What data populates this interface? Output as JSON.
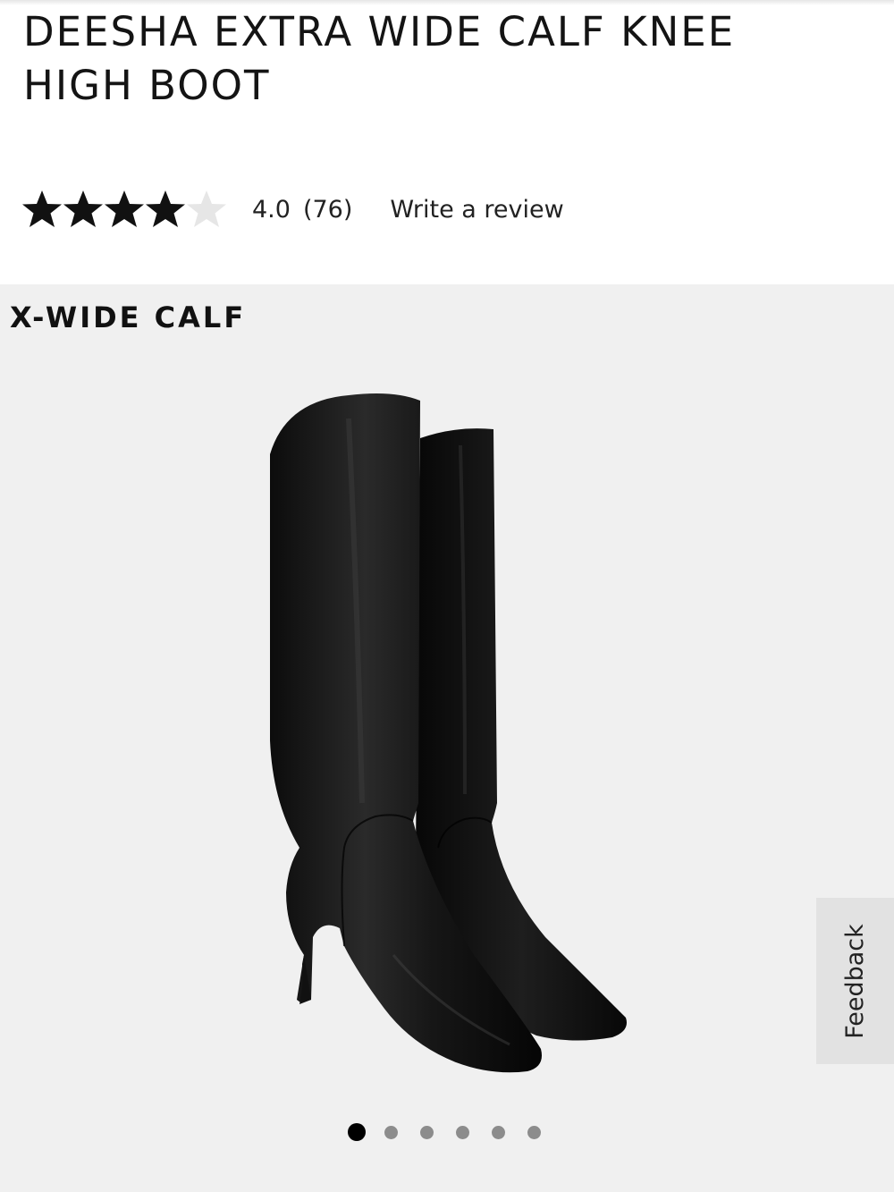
{
  "product": {
    "title": "DEESHA EXTRA WIDE CALF KNEE HIGH BOOT"
  },
  "rating": {
    "value": "4.0",
    "stars_filled": 4,
    "stars_total": 5,
    "count": "(76)",
    "write_review_label": "Write a review",
    "star_color": "#111111",
    "empty_star_color": "#e6e6e6"
  },
  "gallery": {
    "badge": "X-WIDE CALF",
    "image_icon": "black-leather-knee-high-boots",
    "total_images": 6,
    "active_index": 0,
    "background_color": "#f0f0f0"
  },
  "feedback": {
    "label": "Feedback"
  }
}
